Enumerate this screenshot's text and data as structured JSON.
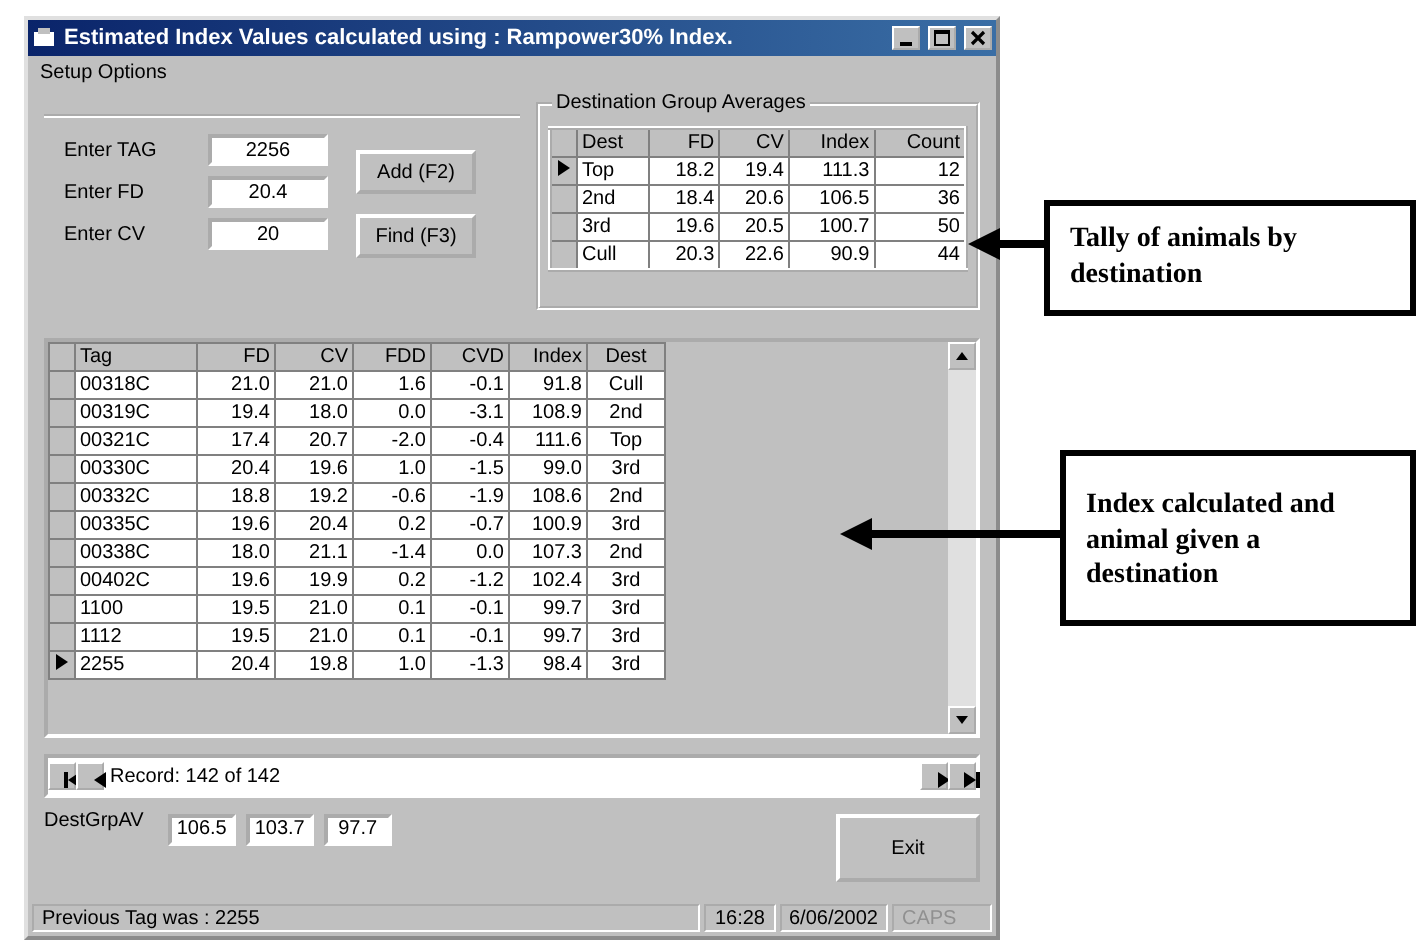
{
  "window": {
    "title": "Estimated Index Values calculated using : Rampower30% Index."
  },
  "menu": [
    "Setup Options"
  ],
  "entry_fields": [
    {
      "label": "Enter TAG",
      "value": "2256"
    },
    {
      "label": "Enter FD",
      "value": "20.4"
    },
    {
      "label": "Enter CV",
      "value": "20"
    }
  ],
  "buttons": [
    "Add (F2)",
    "Find (F3)"
  ],
  "group_averages": {
    "title": "Destination Group Averages",
    "columns": [
      "Dest",
      "FD",
      "CV",
      "Index",
      "Count"
    ],
    "rows": [
      {
        "selected": true,
        "cells": [
          "Top",
          "18.2",
          "19.4",
          "111.3",
          "12"
        ]
      },
      {
        "selected": false,
        "cells": [
          "2nd",
          "18.4",
          "20.6",
          "106.5",
          "36"
        ]
      },
      {
        "selected": false,
        "cells": [
          "3rd",
          "19.6",
          "20.5",
          "100.7",
          "50"
        ]
      },
      {
        "selected": false,
        "cells": [
          "Cull",
          "20.3",
          "22.6",
          "90.9",
          "44"
        ]
      }
    ]
  },
  "grid": {
    "columns": [
      "Tag",
      "FD",
      "CV",
      "FDD",
      "CVD",
      "Index",
      "Dest"
    ],
    "rows": [
      {
        "selected": false,
        "cells": [
          "00318C",
          "21.0",
          "21.0",
          "1.6",
          "-0.1",
          "91.8",
          "Cull"
        ]
      },
      {
        "selected": false,
        "cells": [
          "00319C",
          "19.4",
          "18.0",
          "0.0",
          "-3.1",
          "108.9",
          "2nd"
        ]
      },
      {
        "selected": false,
        "cells": [
          "00321C",
          "17.4",
          "20.7",
          "-2.0",
          "-0.4",
          "111.6",
          "Top"
        ]
      },
      {
        "selected": false,
        "cells": [
          "00330C",
          "20.4",
          "19.6",
          "1.0",
          "-1.5",
          "99.0",
          "3rd"
        ]
      },
      {
        "selected": false,
        "cells": [
          "00332C",
          "18.8",
          "19.2",
          "-0.6",
          "-1.9",
          "108.6",
          "2nd"
        ]
      },
      {
        "selected": false,
        "cells": [
          "00335C",
          "19.6",
          "20.4",
          "0.2",
          "-0.7",
          "100.9",
          "3rd"
        ]
      },
      {
        "selected": false,
        "cells": [
          "00338C",
          "18.0",
          "21.1",
          "-1.4",
          "0.0",
          "107.3",
          "2nd"
        ]
      },
      {
        "selected": false,
        "cells": [
          "00402C",
          "19.6",
          "19.9",
          "0.2",
          "-1.2",
          "102.4",
          "3rd"
        ]
      },
      {
        "selected": false,
        "cells": [
          "1100",
          "19.5",
          "21.0",
          "0.1",
          "-0.1",
          "99.7",
          "3rd"
        ]
      },
      {
        "selected": false,
        "cells": [
          "1112",
          "19.5",
          "21.0",
          "0.1",
          "-0.1",
          "99.7",
          "3rd"
        ]
      },
      {
        "selected": true,
        "cells": [
          "2255",
          "20.4",
          "19.8",
          "1.0",
          "-1.3",
          "98.4",
          "3rd"
        ]
      }
    ]
  },
  "navigator": {
    "record": "Record: 142 of 142"
  },
  "dest_grp_av": {
    "label": "DestGrpAV",
    "values": [
      "106.5",
      "103.7",
      "97.7"
    ]
  },
  "exit_button": "Exit",
  "status_bar": {
    "message": "Previous Tag was : 2255",
    "time": "16:28",
    "date": "6/06/2002",
    "caps": "CAPS"
  },
  "callouts": [
    "Tally of animals by destination",
    "Index calculated and animal given a destination"
  ]
}
